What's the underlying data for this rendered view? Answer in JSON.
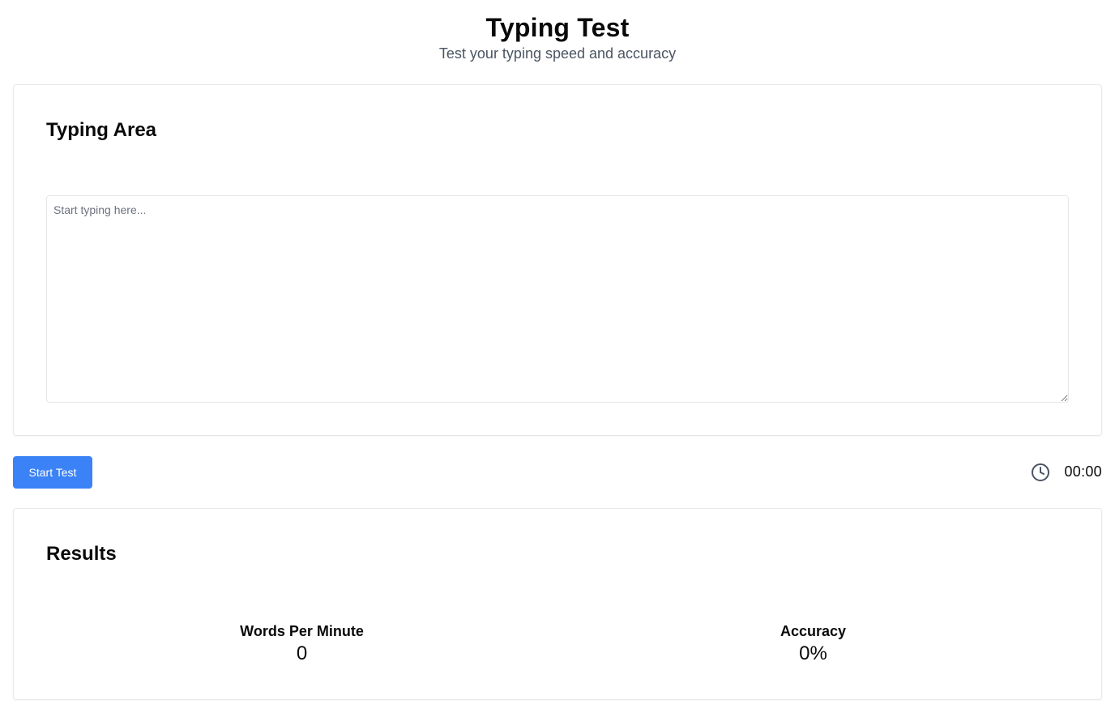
{
  "header": {
    "title": "Typing Test",
    "subtitle": "Test your typing speed and accuracy"
  },
  "typing_area": {
    "title": "Typing Area",
    "input_value": "",
    "input_placeholder": "Start typing here..."
  },
  "controls": {
    "start_label": "Start Test",
    "timer_icon": "clock-icon",
    "timer_value": "00:00",
    "accent_color": "#3b82f6"
  },
  "results": {
    "title": "Results",
    "stats": [
      {
        "label": "Words Per Minute",
        "value": "0"
      },
      {
        "label": "Accuracy",
        "value": "0%"
      }
    ]
  }
}
